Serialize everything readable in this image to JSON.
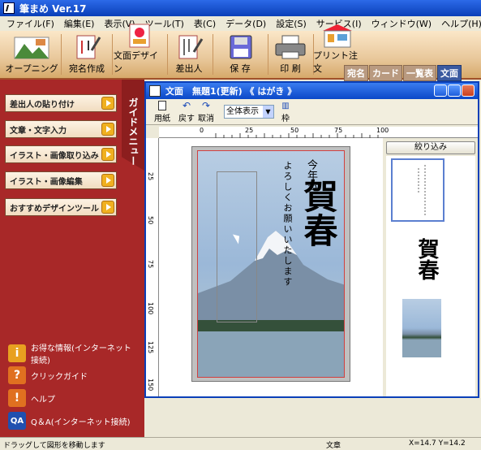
{
  "app": {
    "title": "筆まめ Ver.17"
  },
  "menu": [
    "ファイル(F)",
    "編集(E)",
    "表示(V)",
    "ツール(T)",
    "表(C)",
    "データ(D)",
    "設定(S)",
    "サービス(I)",
    "ウィンドウ(W)",
    "ヘルプ(H)"
  ],
  "toolbar": {
    "buttons": [
      {
        "label": "オープニング",
        "icon": "opening-icon"
      },
      {
        "label": "宛名作成",
        "icon": "address-create-icon"
      },
      {
        "label": "文面デザイン",
        "icon": "design-icon"
      },
      {
        "label": "差出人",
        "icon": "sender-icon"
      },
      {
        "label": "保 存",
        "icon": "floppy-save-icon"
      },
      {
        "label": "印 刷",
        "icon": "printer-icon"
      },
      {
        "label": "プリント注文",
        "icon": "print-order-icon"
      }
    ],
    "tabs": [
      "宛名",
      "カード",
      "一覧表",
      "文面"
    ],
    "active_tab": "文面"
  },
  "guide": {
    "title": "ガイドメニュー",
    "buttons": [
      "差出人の貼り付け",
      "文章・文字入力",
      "イラスト・画像取り込み",
      "イラスト・画像編集",
      "おすすめデザインツール"
    ],
    "links": [
      {
        "label": "お得な情報(インターネット接続)",
        "icon": "info-icon"
      },
      {
        "label": "クリックガイド",
        "icon": "question-icon"
      },
      {
        "label": "ヘルプ",
        "icon": "help-icon"
      },
      {
        "label": "Q＆A(インターネット接続)",
        "icon": "qa-icon"
      }
    ]
  },
  "document": {
    "title": "文面　無題1(更新) 《 はがき 》",
    "toolbar": {
      "paper_label": "用紙",
      "undo_label": "戻す",
      "cancel_label": "取消",
      "zoom_value": "全体表示",
      "frame_label": "枠"
    },
    "card": {
      "line1": "今年も",
      "line2": "よろしくお願いいたします",
      "main": "賀春"
    },
    "side": {
      "filter_label": "絞り込み"
    }
  },
  "status": {
    "message": "ドラッグして図形を移動します",
    "mode": "文章",
    "coords": "X=14.7  Y=14.2"
  },
  "ruler": {
    "h_ticks": [
      "0",
      "25",
      "50",
      "75",
      "100"
    ],
    "v_ticks": [
      "25",
      "50",
      "75",
      "100",
      "125",
      "150"
    ]
  },
  "colors": {
    "left_panel": "#a82828",
    "title_blue": "#0a3fb8",
    "toolbar_bg": "#e8c79a"
  }
}
